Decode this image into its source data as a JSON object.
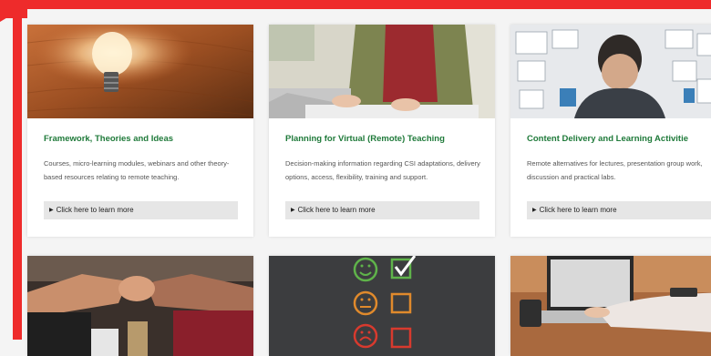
{
  "colors": {
    "frame": "#ee2b2b",
    "title_green": "#1f7a3a",
    "link_bg": "#e6e6e6"
  },
  "cards": [
    {
      "title": "Framework, Theories and Ideas",
      "desc": "Courses, micro-learning modules, webinars and other theory-based resources relating to remote teaching.",
      "link": "Click here to learn more",
      "image": "lightbulb-on-wood-image"
    },
    {
      "title": "Planning for Virtual (Remote) Teaching",
      "desc": "Decision-making information regarding CSI adaptations, delivery options, access, flexibility, training and support.",
      "link": "Click here to learn more",
      "image": "person-typing-laptop-image"
    },
    {
      "title": "Content Delivery and Learning Activitie",
      "desc": "Remote alternatives for lectures, presentation group work, discussion and practical labs.",
      "link": "Click here to learn more",
      "image": "man-facing-whiteboard-image"
    }
  ],
  "row2": [
    {
      "image": "team-fist-bump-image"
    },
    {
      "image": "feedback-faces-chalkboard-image"
    },
    {
      "image": "hands-on-laptop-image"
    }
  ]
}
